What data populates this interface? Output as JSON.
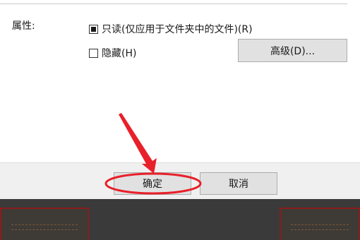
{
  "properties_section": {
    "label": "属性:",
    "readonly_checkbox": {
      "label": "只读(仅应用于文件夹中的文件)(R)",
      "state": "indeterminate"
    },
    "hidden_checkbox": {
      "label": "隐藏(H)",
      "state": "unchecked"
    },
    "advanced_button": "高级(D)..."
  },
  "footer": {
    "ok_button": "确定",
    "cancel_button": "取消"
  },
  "annotation": {
    "arrow_color": "#e8202a",
    "highlight_ring_color": "#e8202a",
    "highlight_target": "ok-button"
  }
}
